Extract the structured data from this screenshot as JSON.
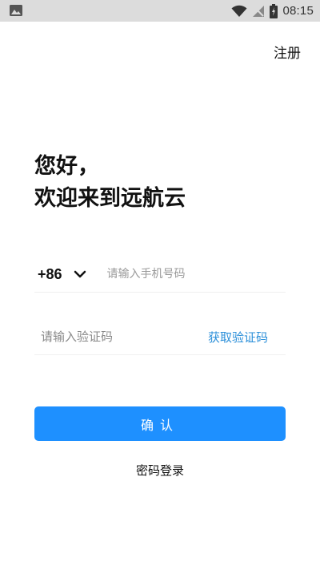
{
  "status_bar": {
    "time": "08:15",
    "icons": [
      "image-icon",
      "wifi-icon",
      "signal-icon",
      "battery-icon"
    ]
  },
  "header": {
    "register_label": "注册"
  },
  "greeting": {
    "line1": "您好，",
    "line2": "欢迎来到远航云"
  },
  "phone": {
    "country_code": "+86",
    "placeholder": "请输入手机号码",
    "value": ""
  },
  "verification": {
    "placeholder": "请输入验证码",
    "value": "",
    "get_code_label": "获取验证码"
  },
  "actions": {
    "confirm_label": "确认",
    "password_login_label": "密码登录"
  },
  "colors": {
    "primary": "#1e90ff",
    "link": "#2b8fd9",
    "status_bar_bg": "#dcdcdc"
  }
}
